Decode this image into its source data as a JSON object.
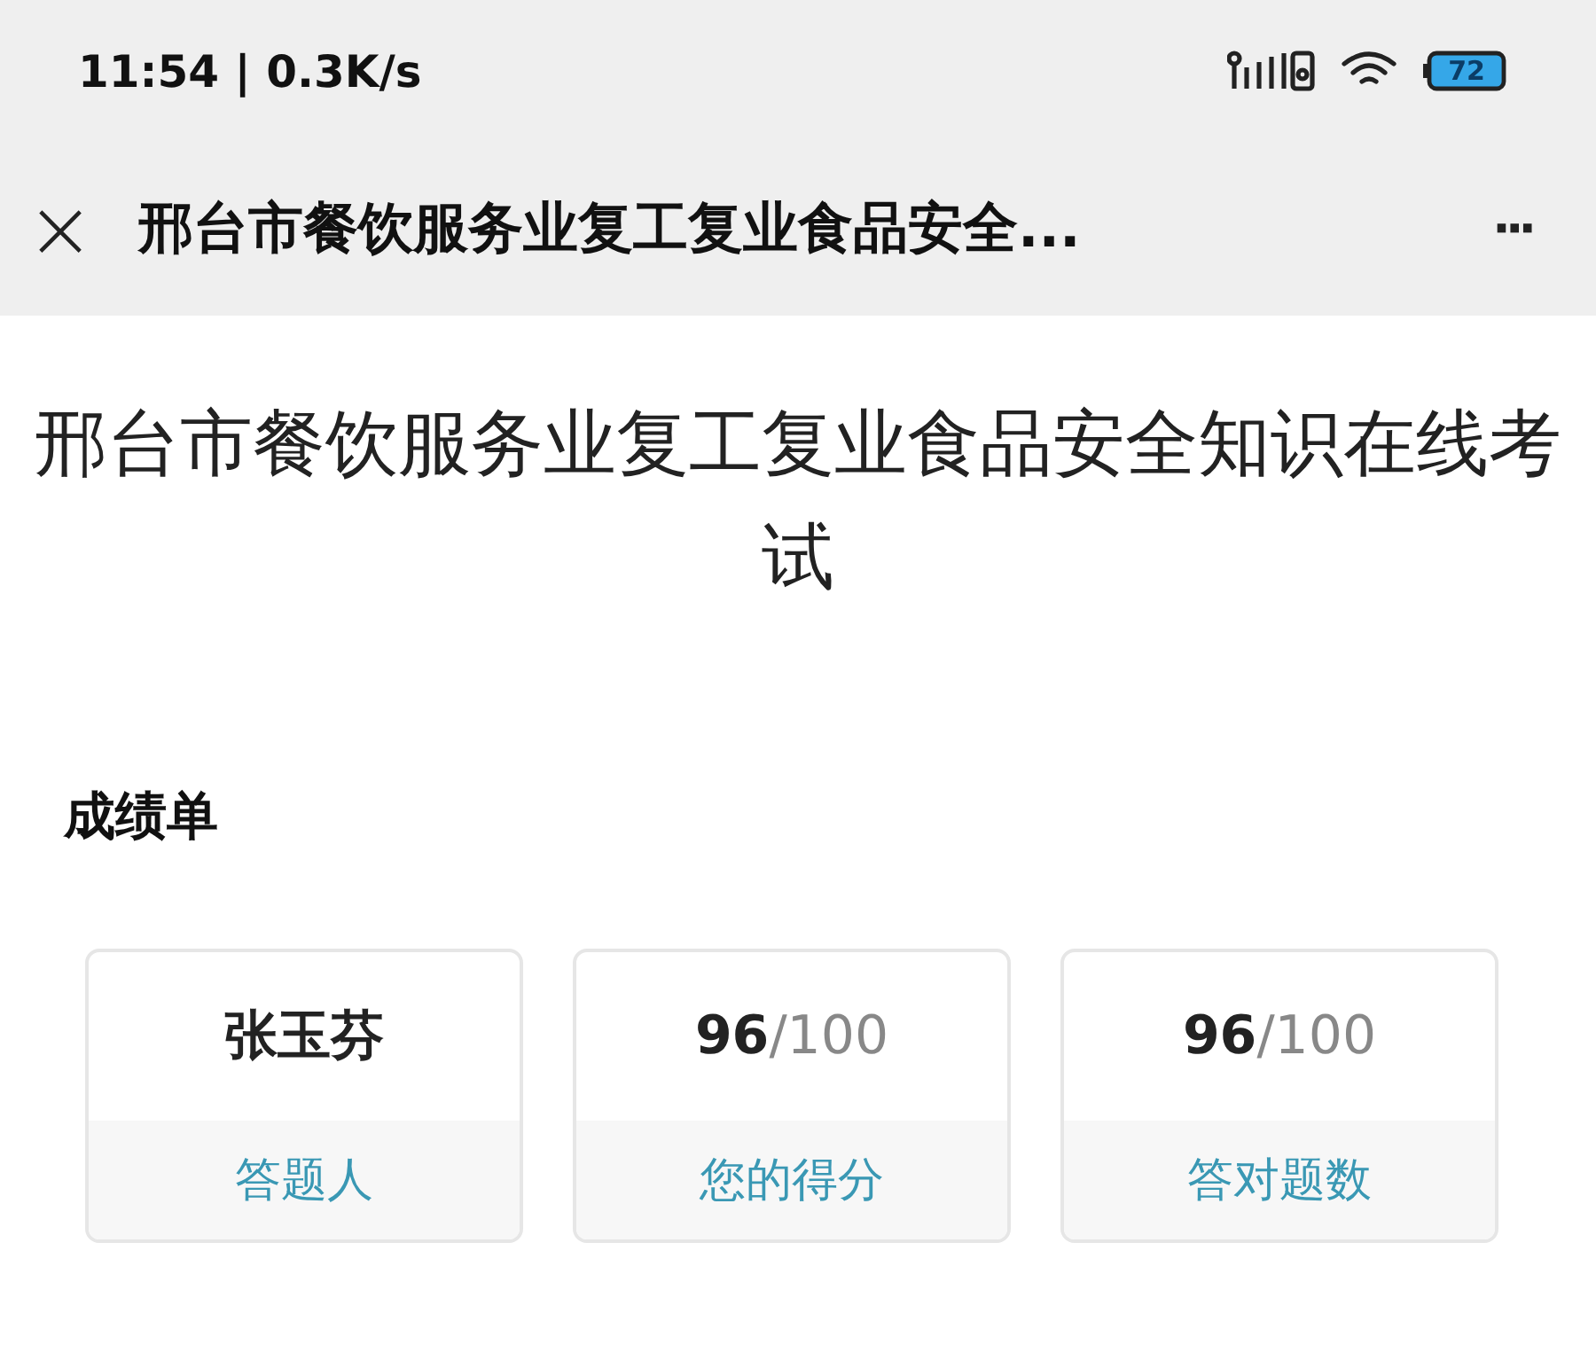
{
  "status_bar": {
    "time": "11:54 | 0.3K/s",
    "battery": "72"
  },
  "nav_bar": {
    "close": "×",
    "title": "邢台市餐饮服务业复工复业食品安全...",
    "more": "···"
  },
  "page_title": "邢台市餐饮服务业复工复业食品安全知识在线考试",
  "section_title": "成绩单",
  "cards": [
    {
      "kind": "name",
      "value": "张玉芬",
      "label": "答题人"
    },
    {
      "kind": "score",
      "value": "**96**/100",
      "label": "您的得分"
    },
    {
      "kind": "score",
      "value": "**96**/100",
      "label": "答对题数"
    }
  ]
}
